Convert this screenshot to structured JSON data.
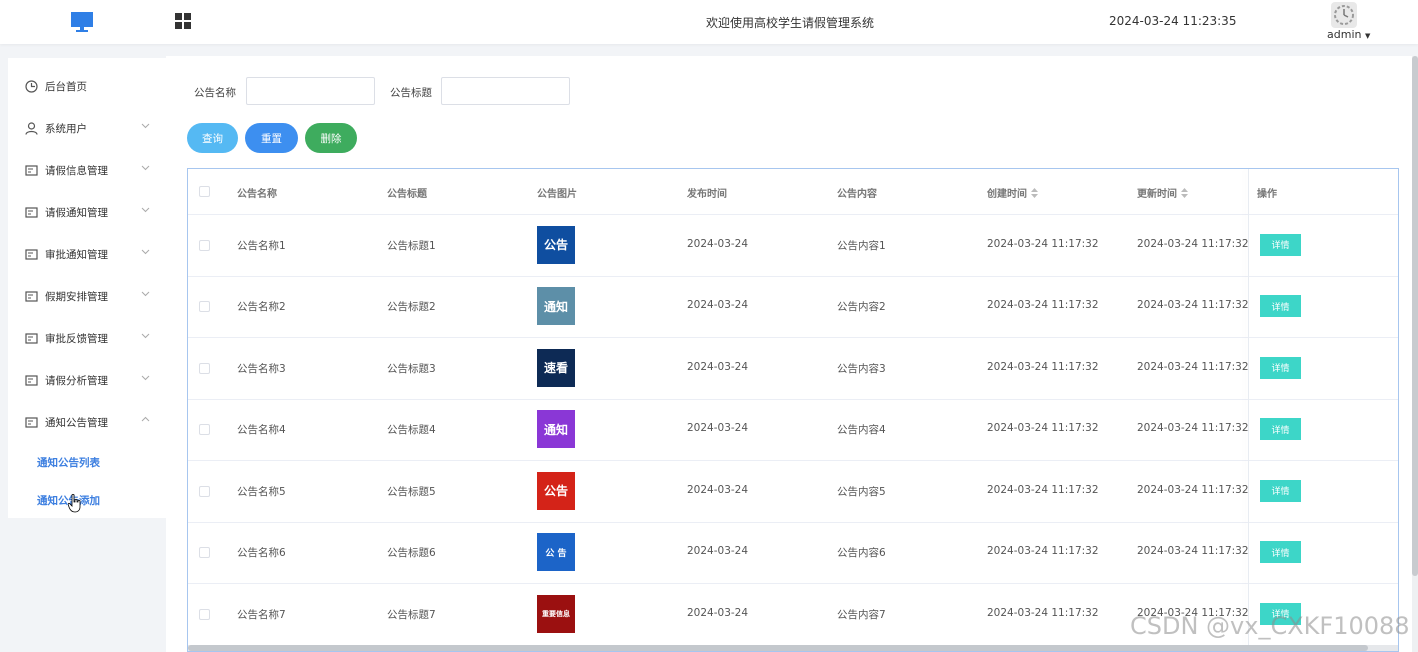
{
  "header": {
    "title": "欢迎使用高校学生请假管理系统",
    "datetime": "2024-03-24 11:23:35",
    "user": "admin",
    "logo_icon": "monitor-icon",
    "menu_icon": "grid-icon"
  },
  "sidebar": {
    "items": [
      {
        "label": "后台首页",
        "icon": "clock-icon"
      },
      {
        "label": "系统用户",
        "icon": "user-icon"
      },
      {
        "label": "请假信息管理",
        "icon": "card-icon"
      },
      {
        "label": "请假通知管理",
        "icon": "card-icon"
      },
      {
        "label": "审批通知管理",
        "icon": "card-icon"
      },
      {
        "label": "假期安排管理",
        "icon": "card-icon"
      },
      {
        "label": "审批反馈管理",
        "icon": "card-icon"
      },
      {
        "label": "请假分析管理",
        "icon": "card-icon"
      },
      {
        "label": "通知公告管理",
        "icon": "card-icon"
      }
    ],
    "subitems": [
      {
        "label": "通知公告列表"
      },
      {
        "label": "通知公告添加"
      }
    ]
  },
  "filters": {
    "name_label": "公告名称",
    "name_value": "",
    "title_label": "公告标题",
    "title_value": ""
  },
  "buttons": {
    "query": "查询",
    "reset": "重置",
    "delete": "删除"
  },
  "colors": {
    "query": "#55b9f3",
    "reset": "#3d8ff0",
    "delete": "#3eac5e",
    "detail": "#3dd6c8",
    "active_link": "#3d7fe0"
  },
  "table": {
    "headers": [
      "公告名称",
      "公告标题",
      "公告图片",
      "发布时间",
      "公告内容",
      "创建时间",
      "更新时间",
      "操作"
    ],
    "detail_label": "详情",
    "rows": [
      {
        "name": "公告名称1",
        "title": "公告标题1",
        "image_text": "公告",
        "image_bg": "#0f4ea0",
        "publish": "2024-03-24",
        "content": "公告内容1",
        "created": "2024-03-24 11:17:32",
        "updated": "2024-03-24 11:17:32"
      },
      {
        "name": "公告名称2",
        "title": "公告标题2",
        "image_text": "通知",
        "image_bg": "#5d8fa8",
        "publish": "2024-03-24",
        "content": "公告内容2",
        "created": "2024-03-24 11:17:32",
        "updated": "2024-03-24 11:17:32"
      },
      {
        "name": "公告名称3",
        "title": "公告标题3",
        "image_text": "速看",
        "image_bg": "#0d2a55",
        "publish": "2024-03-24",
        "content": "公告内容3",
        "created": "2024-03-24 11:17:32",
        "updated": "2024-03-24 11:17:32"
      },
      {
        "name": "公告名称4",
        "title": "公告标题4",
        "image_text": "通知",
        "image_bg": "#8a37d6",
        "publish": "2024-03-24",
        "content": "公告内容4",
        "created": "2024-03-24 11:17:32",
        "updated": "2024-03-24 11:17:32"
      },
      {
        "name": "公告名称5",
        "title": "公告标题5",
        "image_text": "公告",
        "image_bg": "#d42318",
        "publish": "2024-03-24",
        "content": "公告内容5",
        "created": "2024-03-24 11:17:32",
        "updated": "2024-03-24 11:17:32"
      },
      {
        "name": "公告名称6",
        "title": "公告标题6",
        "image_text": "公 告",
        "image_bg": "#1c64c8",
        "publish": "2024-03-24",
        "content": "公告内容6",
        "created": "2024-03-24 11:17:32",
        "updated": "2024-03-24 11:17:32"
      },
      {
        "name": "公告名称7",
        "title": "公告标题7",
        "image_text": "重要信息",
        "image_bg": "#9b1010",
        "publish": "2024-03-24",
        "content": "公告内容7",
        "created": "2024-03-24 11:17:32",
        "updated": "2024-03-24 11:17:32"
      }
    ]
  },
  "watermark": "CSDN @vx_CXKF10088"
}
